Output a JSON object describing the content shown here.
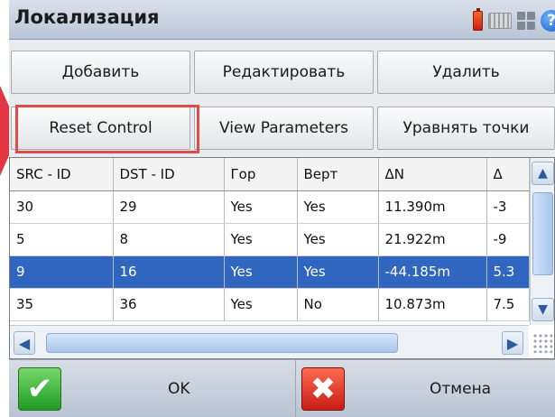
{
  "window": {
    "title": "Локализация"
  },
  "toolbar": {
    "add_label": "Добавить",
    "edit_label": "Редактировать",
    "delete_label": "Удалить",
    "reset_control_label": "Reset Control",
    "view_parameters_label": "View Parameters",
    "adjust_points_label": "Уравнять точки"
  },
  "table": {
    "headers": [
      "SRC - ID",
      "DST - ID",
      "Гор",
      "Верт",
      "ΔN",
      "Δ"
    ],
    "rows": [
      [
        "30",
        "29",
        "Yes",
        "Yes",
        "11.390m",
        "-3"
      ],
      [
        "5",
        "8",
        "Yes",
        "Yes",
        "21.922m",
        "-9"
      ],
      [
        "9",
        "16",
        "Yes",
        "Yes",
        "-44.185m",
        "5.3"
      ],
      [
        "35",
        "36",
        "Yes",
        "No",
        "10.873m",
        "7.5"
      ]
    ],
    "selected_row": 2
  },
  "footer": {
    "ok_label": "OK",
    "cancel_label": "Отмена"
  },
  "colors": {
    "selection": "#3166c0",
    "highlight_frame": "#e34a4a",
    "ok": "#1f9a25",
    "cancel": "#c81d15"
  },
  "icons": [
    "battery-icon",
    "keyboard-icon",
    "grid-icon",
    "help-icon",
    "check-icon",
    "cancel-x-icon",
    "chevron-up-icon",
    "chevron-down-icon",
    "chevron-left-icon",
    "chevron-right-icon"
  ]
}
